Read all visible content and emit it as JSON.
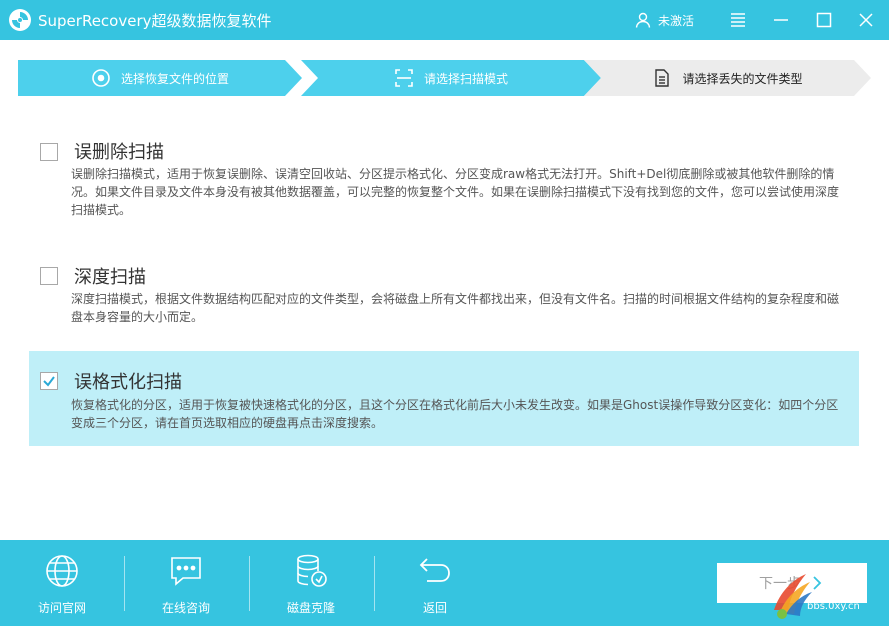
{
  "window": {
    "title": "SuperRecovery超级数据恢复软件",
    "user_label": "未激活"
  },
  "steps": [
    {
      "label": "选择恢复文件的位置",
      "icon": "disc-icon",
      "state": "done"
    },
    {
      "label": "请选择扫描模式",
      "icon": "scan-frame-icon",
      "state": "done"
    },
    {
      "label": "请选择丢失的文件类型",
      "icon": "document-icon",
      "state": "current"
    }
  ],
  "options": [
    {
      "title": "误删除扫描",
      "checked": false,
      "desc": "误删除扫描模式，适用于恢复误删除、误清空回收站、分区提示格式化、分区变成raw格式无法打开。Shift+Del彻底删除或被其他软件删除的情况。如果文件目录及文件本身没有被其他数据覆盖，可以完整的恢复整个文件。如果在误删除扫描模式下没有找到您的文件，您可以尝试使用深度扫描模式。"
    },
    {
      "title": "深度扫描",
      "checked": false,
      "desc": "深度扫描模式，根据文件数据结构匹配对应的文件类型，会将磁盘上所有文件都找出来，但没有文件名。扫描的时间根据文件结构的复杂程度和磁盘本身容量的大小而定。"
    },
    {
      "title": "误格式化扫描",
      "checked": true,
      "desc": "恢复格式化的分区，适用于恢复被快速格式化的分区，且这个分区在格式化前后大小未发生改变。如果是Ghost误操作导致分区变化：如四个分区变成三个分区，请在首页选取相应的硬盘再点击深度搜索。"
    }
  ],
  "bottom": {
    "tools": [
      {
        "label": "访问官网",
        "icon": "globe-icon"
      },
      {
        "label": "在线咨询",
        "icon": "chat-icon"
      },
      {
        "label": "磁盘克隆",
        "icon": "disk-clone-icon"
      },
      {
        "label": "返回",
        "icon": "return-arrow-icon"
      }
    ],
    "next_label": "下一步"
  },
  "watermark": {
    "text": "bbs.0xy.cn"
  },
  "colors": {
    "accent": "#36c4e0",
    "step_active": "#4dd0ec",
    "step_inactive": "#ececec",
    "selected_row": "#bfeff8",
    "check_color": "#2aa9d6"
  }
}
